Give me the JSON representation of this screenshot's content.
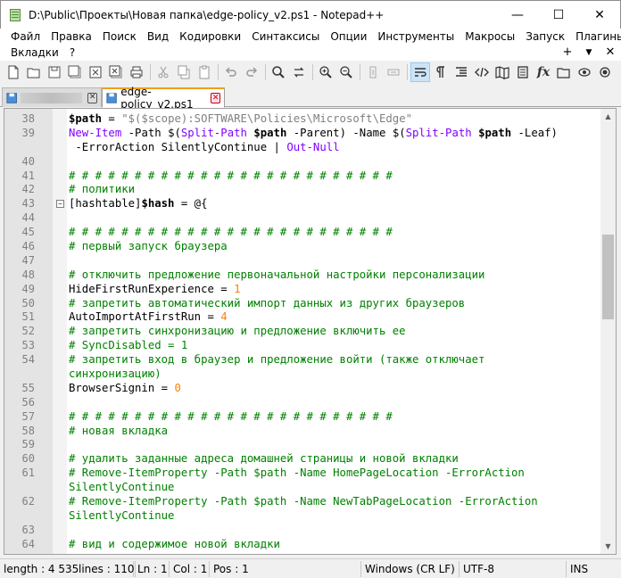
{
  "window": {
    "title": "D:\\Public\\Проекты\\Новая папка\\edge-policy_v2.ps1 - Notepad++",
    "minimize": "—",
    "maximize": "☐",
    "close": "✕"
  },
  "menu": {
    "row1": [
      "Файл",
      "Правка",
      "Поиск",
      "Вид",
      "Кодировки",
      "Синтаксисы",
      "Опции",
      "Инструменты",
      "Макросы",
      "Запуск",
      "Плагины"
    ],
    "row2": [
      "Вкладки",
      "?"
    ],
    "row2_right": [
      "+",
      "▼",
      "✕"
    ]
  },
  "toolbar": {
    "icons": [
      "new-file-icon",
      "open-folder-icon",
      "save-icon",
      "save-all-icon",
      "close-icon",
      "close-all-icon",
      "print-icon",
      "cut-icon",
      "copy-icon",
      "paste-icon",
      "undo-icon",
      "redo-icon",
      "find-icon",
      "replace-icon",
      "zoom-in-icon",
      "zoom-out-icon",
      "sync-v-icon",
      "sync-h-icon",
      "word-wrap-icon",
      "show-all-chars-icon",
      "indent-guide-icon",
      "xml-tag-icon",
      "document-map-icon",
      "function-list-icon",
      "folder-workspace-icon",
      "monitoring-icon",
      "record-macro-icon"
    ]
  },
  "tabs": [
    {
      "label": "",
      "active": false
    },
    {
      "label": "edge-policy_v2.ps1",
      "active": true
    }
  ],
  "editor": {
    "lines": [
      {
        "n": "38",
        "fold": false,
        "segs": [
          [
            "var",
            "$path"
          ],
          [
            "op",
            " = "
          ],
          [
            "str",
            "\"$($scope):SOFTWARE\\Policies\\Microsoft\\Edge\""
          ]
        ]
      },
      {
        "n": "39",
        "fold": false,
        "segs": [
          [
            "cmd",
            "New-Item"
          ],
          [
            "op",
            " -Path "
          ],
          [
            "op",
            "$("
          ],
          [
            "cmd",
            "Split-Path"
          ],
          [
            "op",
            " "
          ],
          [
            "var",
            "$path"
          ],
          [
            "op",
            " -Parent) -Name $("
          ],
          [
            "cmd",
            "Split-Path"
          ],
          [
            "op",
            " "
          ],
          [
            "var",
            "$path"
          ],
          [
            "op",
            " -Leaf)"
          ]
        ]
      },
      {
        "n": "",
        "fold": false,
        "segs": [
          [
            "op",
            " -ErrorAction SilentlyContinue | "
          ],
          [
            "cmd",
            "Out-Null"
          ]
        ]
      },
      {
        "n": "40",
        "fold": false,
        "segs": []
      },
      {
        "n": "41",
        "fold": false,
        "segs": [
          [
            "cm",
            "# # # # # # # # # # # # # # # # # # # # # # # # #"
          ]
        ]
      },
      {
        "n": "42",
        "fold": false,
        "segs": [
          [
            "cm",
            "# политики"
          ]
        ]
      },
      {
        "n": "43",
        "fold": true,
        "segs": [
          [
            "op",
            "[hashtable]"
          ],
          [
            "var",
            "$hash"
          ],
          [
            "op",
            " = @{"
          ]
        ]
      },
      {
        "n": "44",
        "fold": false,
        "segs": []
      },
      {
        "n": "45",
        "fold": false,
        "segs": [
          [
            "cm",
            "# # # # # # # # # # # # # # # # # # # # # # # # #"
          ]
        ]
      },
      {
        "n": "46",
        "fold": false,
        "segs": [
          [
            "cm",
            "# первый запуск браузера"
          ]
        ]
      },
      {
        "n": "47",
        "fold": false,
        "segs": []
      },
      {
        "n": "48",
        "fold": false,
        "segs": [
          [
            "cm",
            "# отключить предложение первоначальной настройки персонализации"
          ]
        ]
      },
      {
        "n": "49",
        "fold": false,
        "segs": [
          [
            "txt",
            "HideFirstRunExperience"
          ],
          [
            "op",
            " = "
          ],
          [
            "num",
            "1"
          ]
        ]
      },
      {
        "n": "50",
        "fold": false,
        "segs": [
          [
            "cm",
            "# запретить автоматический импорт данных из других браузеров"
          ]
        ]
      },
      {
        "n": "51",
        "fold": false,
        "segs": [
          [
            "txt",
            "AutoImportAtFirstRun"
          ],
          [
            "op",
            " = "
          ],
          [
            "num",
            "4"
          ]
        ]
      },
      {
        "n": "52",
        "fold": false,
        "segs": [
          [
            "cm",
            "# запретить синхронизацию и предложение включить ее"
          ]
        ]
      },
      {
        "n": "53",
        "fold": false,
        "segs": [
          [
            "cm",
            "# SyncDisabled = 1"
          ]
        ]
      },
      {
        "n": "54",
        "fold": false,
        "segs": [
          [
            "cm",
            "# запретить вход в браузер и предложение войти (также отключает"
          ]
        ]
      },
      {
        "n": "",
        "fold": false,
        "segs": [
          [
            "cm",
            "синхронизацию)"
          ]
        ]
      },
      {
        "n": "55",
        "fold": false,
        "segs": [
          [
            "txt",
            "BrowserSignin"
          ],
          [
            "op",
            " = "
          ],
          [
            "num",
            "0"
          ]
        ]
      },
      {
        "n": "56",
        "fold": false,
        "segs": []
      },
      {
        "n": "57",
        "fold": false,
        "segs": [
          [
            "cm",
            "# # # # # # # # # # # # # # # # # # # # # # # # #"
          ]
        ]
      },
      {
        "n": "58",
        "fold": false,
        "segs": [
          [
            "cm",
            "# новая вкладка"
          ]
        ]
      },
      {
        "n": "59",
        "fold": false,
        "segs": []
      },
      {
        "n": "60",
        "fold": false,
        "segs": [
          [
            "cm",
            "# удалить заданные адреса домашней страницы и новой вкладки"
          ]
        ]
      },
      {
        "n": "61",
        "fold": false,
        "segs": [
          [
            "cm",
            "# Remove-ItemProperty -Path $path -Name HomePageLocation -ErrorAction"
          ]
        ]
      },
      {
        "n": "",
        "fold": false,
        "segs": [
          [
            "cm",
            "SilentlyContinue"
          ]
        ]
      },
      {
        "n": "62",
        "fold": false,
        "segs": [
          [
            "cm",
            "# Remove-ItemProperty -Path $path -Name NewTabPageLocation -ErrorAction"
          ]
        ]
      },
      {
        "n": "",
        "fold": false,
        "segs": [
          [
            "cm",
            "SilentlyContinue"
          ]
        ]
      },
      {
        "n": "63",
        "fold": false,
        "segs": []
      },
      {
        "n": "64",
        "fold": false,
        "segs": [
          [
            "cm",
            "# вид и содержимое новой вкладки"
          ]
        ]
      }
    ]
  },
  "status": {
    "length": "length : 4 535",
    "lines": "lines : 110",
    "ln": "Ln : 1",
    "col": "Col : 1",
    "pos": "Pos : 1",
    "eol": "Windows (CR LF)",
    "encoding": "UTF-8",
    "mode": "INS"
  }
}
